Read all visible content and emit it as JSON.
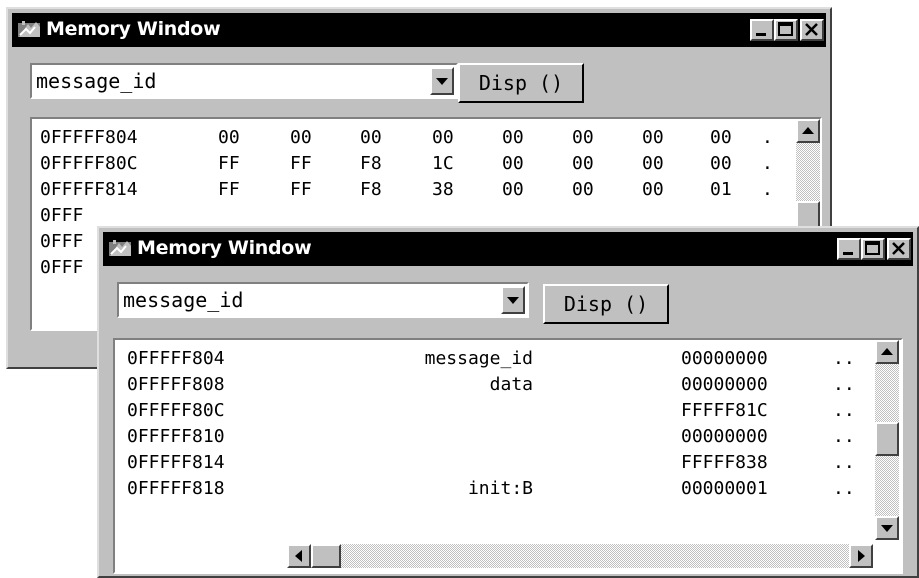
{
  "back_window": {
    "title": "Memory Window",
    "symbol_value": "message_id",
    "disp_label": "Disp ()",
    "rows": [
      {
        "addr": "0FFFFF804",
        "bytes": [
          "00",
          "00",
          "00",
          "00",
          "00",
          "00",
          "00",
          "00"
        ],
        "ascii": "."
      },
      {
        "addr": "0FFFFF80C",
        "bytes": [
          "FF",
          "FF",
          "F8",
          "1C",
          "00",
          "00",
          "00",
          "00"
        ],
        "ascii": "."
      },
      {
        "addr": "0FFFFF814",
        "bytes": [
          "FF",
          "FF",
          "F8",
          "38",
          "00",
          "00",
          "00",
          "01"
        ],
        "ascii": "."
      },
      {
        "addr": "0FFF"
      },
      {
        "addr": "0FFF"
      },
      {
        "addr": "0FFF"
      }
    ]
  },
  "front_window": {
    "title": "Memory Window",
    "symbol_value": "message_id",
    "disp_label": "Disp ()",
    "rows": [
      {
        "addr": "0FFFFF804",
        "symbol": "message_id",
        "value": "00000000",
        "ascii": ".."
      },
      {
        "addr": "0FFFFF808",
        "symbol": "data",
        "value": "00000000",
        "ascii": ".."
      },
      {
        "addr": "0FFFFF80C",
        "symbol": "",
        "value": "FFFFF81C",
        "ascii": ".."
      },
      {
        "addr": "0FFFFF810",
        "symbol": "",
        "value": "00000000",
        "ascii": ".."
      },
      {
        "addr": "0FFFFF814",
        "symbol": "",
        "value": "FFFFF838",
        "ascii": ".."
      },
      {
        "addr": "0FFFFF818",
        "symbol": "init:B",
        "value": "00000001",
        "ascii": ".."
      }
    ]
  },
  "icons": [
    "app-icon",
    "minimize-icon",
    "maximize-icon",
    "close-icon",
    "dropdown-arrow-icon",
    "scroll-up-icon",
    "scroll-down-icon",
    "scroll-left-icon",
    "scroll-right-icon"
  ],
  "colors": {
    "titlebar": "#000000",
    "face": "#c0c0c0",
    "content": "#ffffff"
  }
}
